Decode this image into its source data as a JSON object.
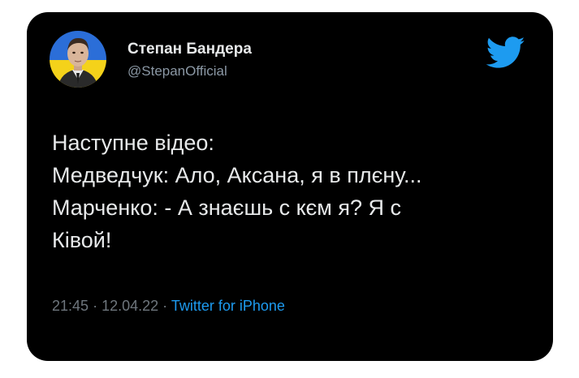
{
  "author": {
    "name": "Степан Бандера",
    "handle": "@StepanOfficial"
  },
  "icons": {
    "logo": "twitter-bird-icon",
    "avatar": "profile-photo"
  },
  "colors": {
    "card_background": "#000000",
    "text": "#e7e9ea",
    "secondary_text": "#8b98a5",
    "link": "#1d9bf0",
    "flag_blue": "#2b6ed8",
    "flag_yellow": "#f4d21a"
  },
  "tweet": {
    "lines": [
      "Наступне відео:",
      "Медведчук: Ало, Аксана, я в плєну...",
      "Марченко: - А знаєшь с кєм я? Я с",
      "Ківой!"
    ]
  },
  "meta": {
    "time": "21:45",
    "separator": "·",
    "date": "12.04.22",
    "source": "Twitter for iPhone"
  }
}
